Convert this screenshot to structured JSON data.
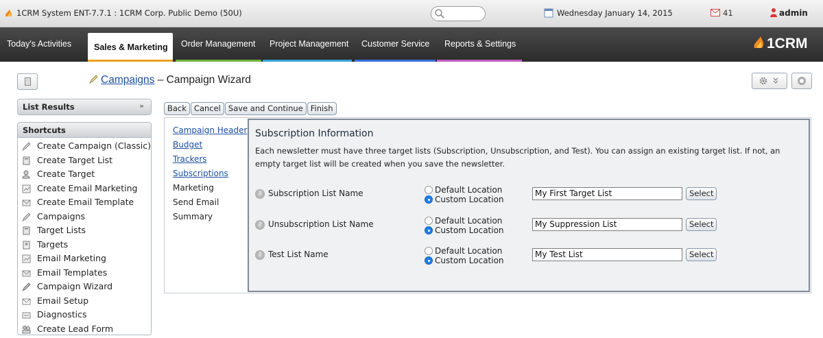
{
  "topbar": {
    "system_title": "1CRM System ENT-7.7.1 : 1CRM Corp. Public Demo (50U)",
    "date": "Wednesday January 14, 2015",
    "mail_count": "41",
    "user": "admin"
  },
  "nav": {
    "tabs": [
      {
        "label": "Today's Activities",
        "color": "#e8a23a"
      },
      {
        "label": "Sales & Marketing",
        "color": "#f0a020"
      },
      {
        "label": "Order Management",
        "color": "#6fb53c"
      },
      {
        "label": "Project Management",
        "color": "#3aa0d8"
      },
      {
        "label": "Customer Service",
        "color": "#3a6fd8"
      },
      {
        "label": "Reports & Settings",
        "color": "#c060c0"
      }
    ],
    "brand": "1CRM"
  },
  "page": {
    "module_link": "Campaigns",
    "separator": "–",
    "title": "Campaign Wizard"
  },
  "sidebar": {
    "list_results": "List Results",
    "shortcuts_title": "Shortcuts",
    "shortcuts": [
      "Create Campaign (Classic)",
      "Create Target List",
      "Create Target",
      "Create Email Marketing",
      "Create Email Template",
      "Campaigns",
      "Target Lists",
      "Targets",
      "Email Marketing",
      "Email Templates",
      "Campaign Wizard",
      "Email Setup",
      "Diagnostics",
      "Create Lead Form"
    ]
  },
  "buttons": {
    "back": "Back",
    "cancel": "Cancel",
    "save_continue": "Save and Continue",
    "finish": "Finish"
  },
  "wizard": {
    "steps": [
      {
        "label": "Campaign Header",
        "link": true
      },
      {
        "label": "Budget",
        "link": true
      },
      {
        "label": "Trackers",
        "link": true
      },
      {
        "label": "Subscriptions",
        "link": true
      },
      {
        "label": "Marketing",
        "link": false
      },
      {
        "label": "Send Email",
        "link": false
      },
      {
        "label": "Summary",
        "link": false
      }
    ],
    "section_title": "Subscription Information",
    "description": "Each newsletter must have three target lists (Subscription, Unsubscription, and Test). You can assign an existing target list. If not, an empty target list will be created when you save the newsletter.",
    "option_default": "Default Location",
    "option_custom": "Custom Location",
    "select_label": "Select",
    "rows": [
      {
        "label": "Subscription List Name",
        "value": "My First Target List",
        "selected": "custom"
      },
      {
        "label": "Unsubscription List Name",
        "value": "My Suppression List",
        "selected": "custom"
      },
      {
        "label": "Test List Name",
        "value": "My Test List",
        "selected": "custom"
      }
    ]
  }
}
